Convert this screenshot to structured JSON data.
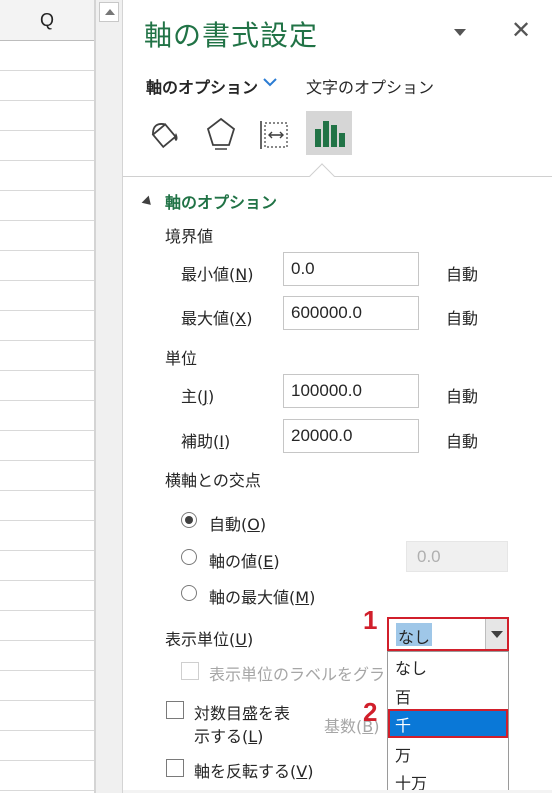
{
  "sheet": {
    "column_header": "Q"
  },
  "pane": {
    "title": "軸の書式設定",
    "tabs": {
      "axis_options": "軸のオプション",
      "text_options": "文字のオプション"
    },
    "icons": [
      "fill-line-icon",
      "effects-icon",
      "size-properties-icon",
      "axis-options-icon"
    ],
    "section": "軸のオプション",
    "bounds": {
      "heading": "境界値",
      "min_label": "最小値(",
      "min_key": "N",
      "max_label": "最大値(",
      "max_key": "X",
      "min_value": "0.0",
      "max_value": "600000.0",
      "auto_text": "自動"
    },
    "units": {
      "heading": "単位",
      "major_label": "主(",
      "major_key": "J",
      "minor_label": "補助(",
      "minor_key": "I",
      "major_value": "100000.0",
      "minor_value": "20000.0",
      "auto_text": "自動"
    },
    "crosses": {
      "heading": "横軸との交点",
      "options": [
        {
          "label": "自動(",
          "key": "O",
          "selected": true
        },
        {
          "label": "軸の値(",
          "key": "E",
          "selected": false
        },
        {
          "label": "軸の最大値(",
          "key": "M",
          "selected": false
        }
      ],
      "value": "0.0"
    },
    "display_units": {
      "label": "表示単位(",
      "key": "U",
      "selected": "なし",
      "options": [
        "なし",
        "百",
        "千",
        "万",
        "十万"
      ],
      "highlighted": "千",
      "show_label_text": "表示単位のラベルをグラフ"
    },
    "log_scale": {
      "label_line1": "対数目盛を表",
      "label_line2": "示する(",
      "key": "L",
      "base_label": "基数(",
      "base_key": "B"
    },
    "reverse": {
      "label": "軸を反転する(",
      "key": "V"
    }
  },
  "annotations": {
    "step1": "1",
    "step2": "2",
    "color": "#d11f2b"
  },
  "colors": {
    "accent_green": "#217346",
    "selection_blue": "#0a78d7"
  }
}
